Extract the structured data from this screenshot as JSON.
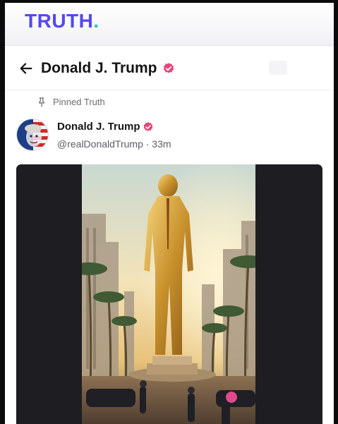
{
  "brand": {
    "logo_text": "TRUTH",
    "logo_dot": ".",
    "logo_color": "#5448ee",
    "dot_color": "#19c6c2"
  },
  "header": {
    "back_icon": "arrow-left-icon",
    "title": "Donald J. Trump",
    "verified_icon": "verified-badge-icon",
    "verified_color": "#e5457a"
  },
  "post": {
    "pinned_label": "Pinned Truth",
    "pinned_icon": "pin-icon",
    "author_name": "Donald J. Trump",
    "author_meta": "@realDonaldTrump · 33m",
    "media_type": "video",
    "media_icon": "video-thumbnail"
  }
}
